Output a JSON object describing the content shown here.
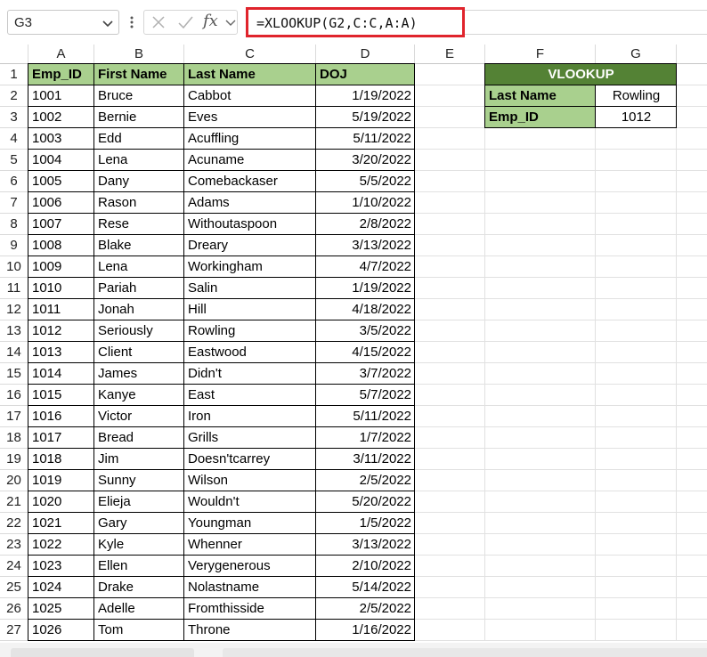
{
  "formula_bar": {
    "name_box": "G3",
    "formula": "=XLOOKUP(G2,C:C,A:A)"
  },
  "icons": {
    "cancel": "close-icon",
    "enter": "check-icon",
    "insert_function": "fx-icon",
    "name_box_dropdown": "chevron-down-icon"
  },
  "colors": {
    "header_fill": "#a9d08e",
    "lookup_title_fill": "#548235",
    "formula_highlight": "#e0242c"
  },
  "column_headers": [
    "A",
    "B",
    "C",
    "D",
    "E",
    "F",
    "G"
  ],
  "table": {
    "headers": [
      "Emp_ID",
      "First Name",
      "Last Name",
      "DOJ"
    ],
    "rows": [
      [
        "1001",
        "Bruce",
        "Cabbot",
        "1/19/2022"
      ],
      [
        "1002",
        "Bernie",
        "Eves",
        "5/19/2022"
      ],
      [
        "1003",
        "Edd",
        "Acuffling",
        "5/11/2022"
      ],
      [
        "1004",
        "Lena",
        "Acuname",
        "3/20/2022"
      ],
      [
        "1005",
        "Dany",
        "Comebackaser",
        "5/5/2022"
      ],
      [
        "1006",
        "Rason",
        "Adams",
        "1/10/2022"
      ],
      [
        "1007",
        "Rese",
        "Withoutaspoon",
        "2/8/2022"
      ],
      [
        "1008",
        "Blake",
        "Dreary",
        "3/13/2022"
      ],
      [
        "1009",
        "Lena",
        "Workingham",
        "4/7/2022"
      ],
      [
        "1010",
        "Pariah",
        "Salin",
        "1/19/2022"
      ],
      [
        "1011",
        "Jonah",
        "Hill",
        "4/18/2022"
      ],
      [
        "1012",
        "Seriously",
        "Rowling",
        "3/5/2022"
      ],
      [
        "1013",
        "Client",
        "Eastwood",
        "4/15/2022"
      ],
      [
        "1014",
        "James",
        "Didn't",
        "3/7/2022"
      ],
      [
        "1015",
        "Kanye",
        "East",
        "5/7/2022"
      ],
      [
        "1016",
        "Victor",
        "Iron",
        "5/11/2022"
      ],
      [
        "1017",
        "Bread",
        "Grills",
        "1/7/2022"
      ],
      [
        "1018",
        "Jim",
        "Doesn'tcarrey",
        "3/11/2022"
      ],
      [
        "1019",
        "Sunny",
        "Wilson",
        "2/5/2022"
      ],
      [
        "1020",
        "Elieja",
        "Wouldn't",
        "5/20/2022"
      ],
      [
        "1021",
        "Gary",
        "Youngman",
        "1/5/2022"
      ],
      [
        "1022",
        "Kyle",
        "Whenner",
        "3/13/2022"
      ],
      [
        "1023",
        "Ellen",
        "Verygenerous",
        "2/10/2022"
      ],
      [
        "1024",
        "Drake",
        "Nolastname",
        "5/14/2022"
      ],
      [
        "1025",
        "Adelle",
        "Fromthisside",
        "2/5/2022"
      ],
      [
        "1026",
        "Tom",
        "Throne",
        "1/16/2022"
      ]
    ]
  },
  "lookup": {
    "title": "VLOOKUP",
    "last_name_label": "Last Name",
    "last_name_value": "Rowling",
    "emp_id_label": "Emp_ID",
    "emp_id_value": "1012"
  }
}
